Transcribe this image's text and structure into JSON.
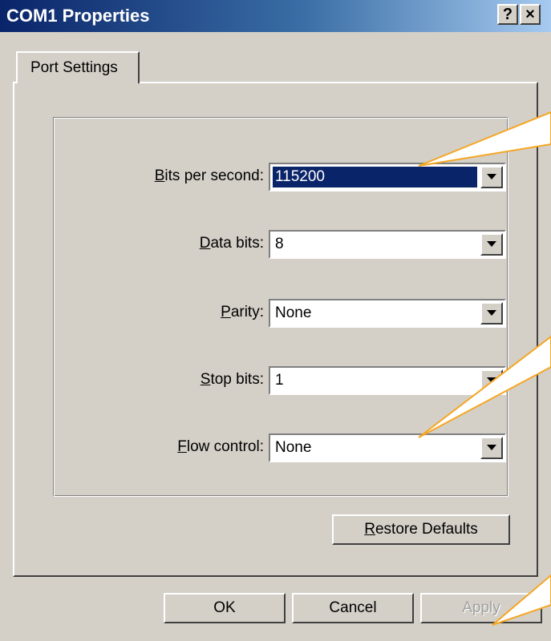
{
  "window": {
    "title": "COM1 Properties",
    "help_button": "?",
    "close_button": "×"
  },
  "tabs": [
    {
      "label": "Port Settings",
      "active": true
    }
  ],
  "fields": {
    "bits_per_second": {
      "mnemonic": "B",
      "label_rest": "its per second:",
      "value": "115200"
    },
    "data_bits": {
      "mnemonic": "D",
      "label_rest": "ata bits:",
      "value": "8"
    },
    "parity": {
      "mnemonic": "P",
      "label_rest": "arity:",
      "value": "None"
    },
    "stop_bits": {
      "mnemonic": "S",
      "label_rest": "top bits:",
      "value": "1"
    },
    "flow_control": {
      "mnemonic": "F",
      "label_rest": "low control:",
      "value": "None"
    }
  },
  "buttons": {
    "restore_mnemonic": "R",
    "restore_rest": "estore Defaults",
    "ok": "OK",
    "cancel": "Cancel",
    "apply": "Apply"
  },
  "colors": {
    "face": "#d4d0c8",
    "title_start": "#0a246a",
    "title_end": "#a6caf0",
    "selection": "#0a246a",
    "callout_stroke": "#f5a623"
  }
}
